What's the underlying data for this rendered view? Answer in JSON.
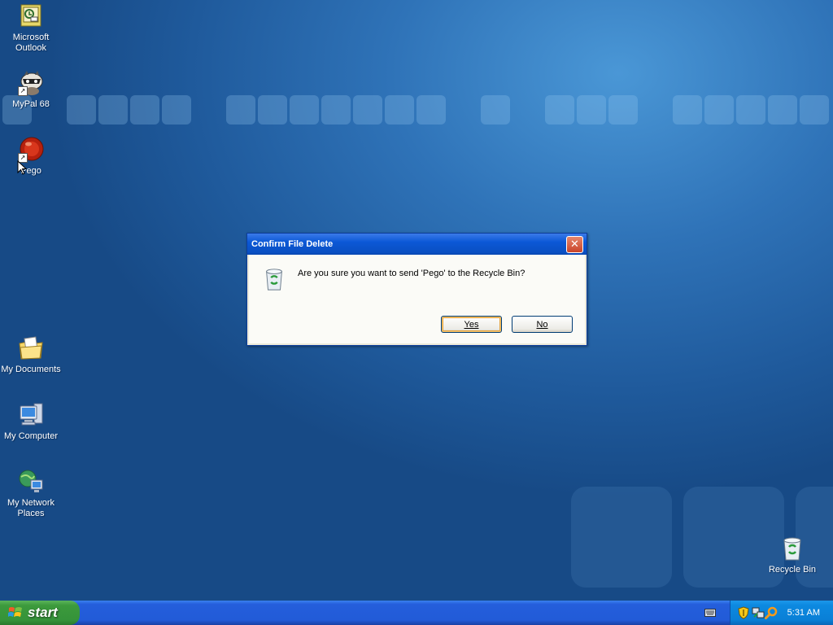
{
  "desktop": {
    "icons": [
      {
        "label": "Microsoft Outlook",
        "icon": "outlook-icon"
      },
      {
        "label": "MyPal 68",
        "icon": "raccoon-icon"
      },
      {
        "label": "Pego",
        "icon": "pego-red-ball-icon"
      },
      {
        "label": "My Documents",
        "icon": "documents-folder-icon"
      },
      {
        "label": "My Computer",
        "icon": "computer-icon"
      },
      {
        "label": "My Network Places",
        "icon": "network-globe-icon"
      },
      {
        "label": "Recycle Bin",
        "icon": "recycle-bin-icon"
      }
    ]
  },
  "dialog": {
    "title": "Confirm File Delete",
    "message": "Are you sure you want to send 'Pego' to the Recycle Bin?",
    "yes_label": "Yes",
    "no_label": "No",
    "close_glyph": "✕"
  },
  "taskbar": {
    "start_label": "start",
    "clock": "5:31 AM",
    "tray_icons": [
      "keyboard-icon",
      "security-shield-icon",
      "network-icon",
      "search-icon"
    ]
  },
  "colors": {
    "desktop_blue": "#2f73b8",
    "title_bar": "#0b58d6",
    "start_green": "#3c9a3c",
    "taskbar_blue": "#245edb"
  }
}
